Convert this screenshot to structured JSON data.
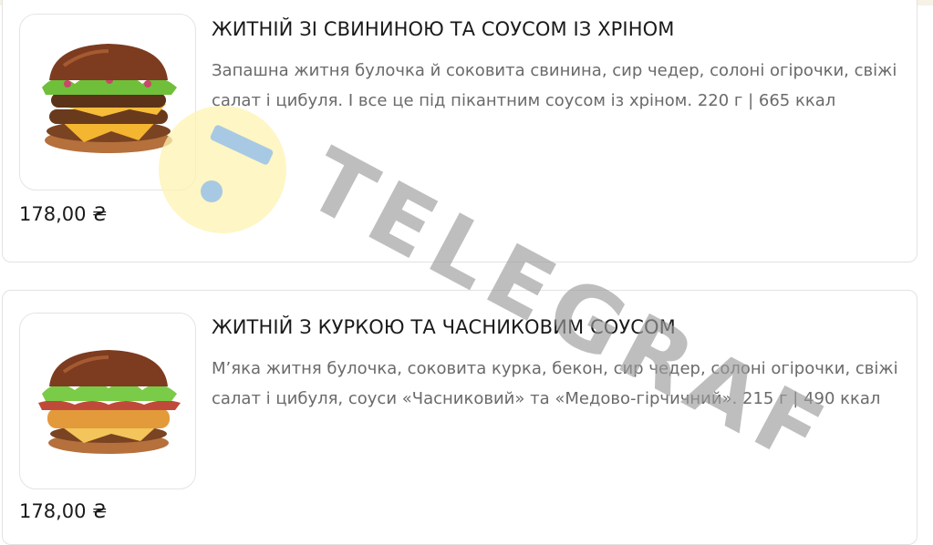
{
  "products": [
    {
      "title": "ЖИТНІЙ ЗІ СВИНИНОЮ ТА СОУСОМ ІЗ ХРІНОМ",
      "description": "Запашна житня булочка й соковита свинина, сир чедер, солоні огірочки, свіжі салат і цибуля. І все це під пікантним соусом із хріном. 220 г | 665 ккал",
      "price": "178,00 ₴",
      "image_icon": "pork-burger-icon"
    },
    {
      "title": "ЖИТНІЙ З КУРКОЮ ТА ЧАСНИКОВИМ СОУСОМ",
      "description": "М’яка житня булочка, соковита курка, бекон, сир чедер, солоні огірочки, свіжі салат і цибуля, соуси «Часниковий» та «Медово-гірчичний». 215 г | 490 ккал",
      "price": "178,00 ₴",
      "image_icon": "chicken-burger-icon"
    }
  ],
  "watermark": {
    "text": "TELEGRAF",
    "color": "#9c9c9c",
    "logo_yellow": "#fdf3b0",
    "logo_blue": "#9ec4e8"
  }
}
